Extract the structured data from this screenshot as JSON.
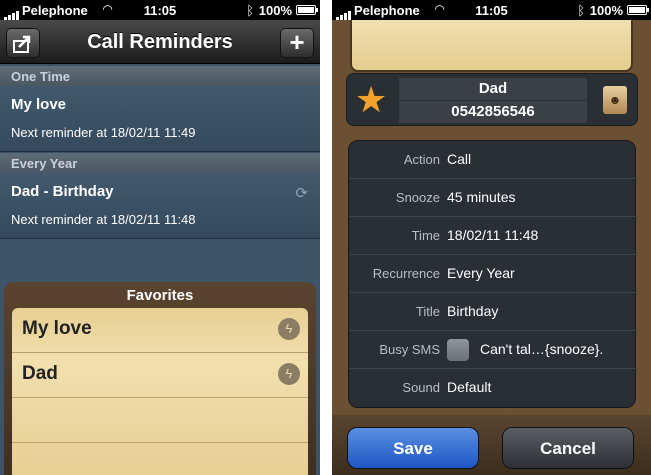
{
  "status": {
    "carrier": "Pelephone",
    "time": "11:05",
    "battery": "100%"
  },
  "list_screen": {
    "title": "Call Reminders",
    "add_label": "+",
    "sections": [
      {
        "header": "One Time",
        "name": "My love",
        "next": "Next reminder at 18/02/11 11:49"
      },
      {
        "header": "Every Year",
        "name": "Dad - Birthday",
        "next": "Next reminder at 18/02/11 11:48"
      }
    ],
    "favorites": {
      "title": "Favorites",
      "items": [
        "My love",
        "Dad"
      ]
    }
  },
  "detail_screen": {
    "contact": {
      "name": "Dad",
      "phone": "0542856546"
    },
    "fields": [
      {
        "label": "Action",
        "value": "Call"
      },
      {
        "label": "Snooze",
        "value": "45 minutes"
      },
      {
        "label": "Time",
        "value": "18/02/11 11:48"
      },
      {
        "label": "Recurrence",
        "value": "Every Year"
      },
      {
        "label": "Title",
        "value": "Birthday"
      },
      {
        "label": "Busy SMS",
        "value": "Can't tal…{snooze}."
      },
      {
        "label": "Sound",
        "value": "Default"
      }
    ],
    "save_label": "Save",
    "cancel_label": "Cancel"
  },
  "icons": [
    "share-icon",
    "plus-icon",
    "repeat-icon",
    "bolt-icon",
    "star-icon",
    "contacts-icon",
    "wifi-icon",
    "bluetooth-icon",
    "battery-icon"
  ],
  "colors": {
    "save": "#1d56c4",
    "star": "#f2a12b",
    "paper": "#f1dfae"
  }
}
